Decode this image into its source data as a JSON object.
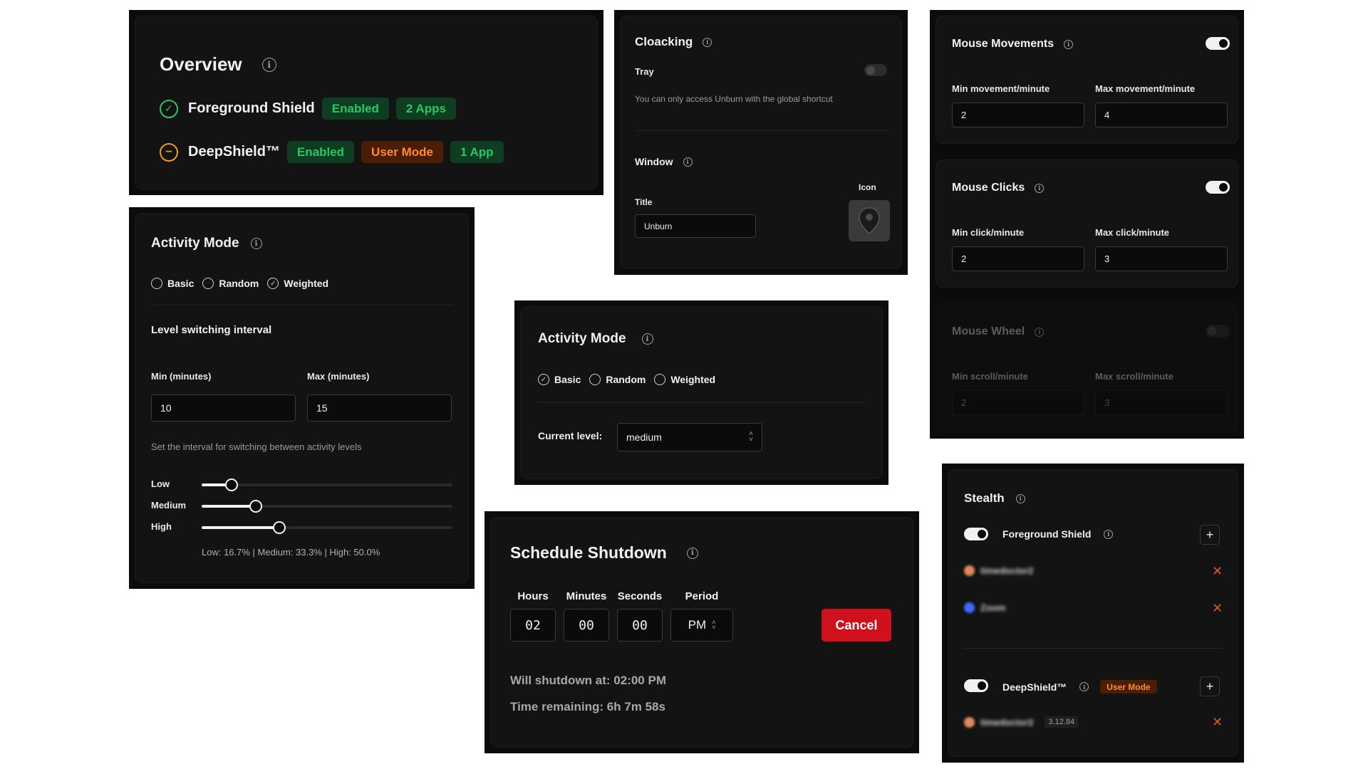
{
  "overview": {
    "title": "Overview",
    "rows": [
      {
        "name": "Foreground Shield",
        "badges": [
          "Enabled",
          "2 Apps"
        ]
      },
      {
        "name": "DeepShield™",
        "badges": [
          "Enabled",
          "User Mode",
          "1 App"
        ]
      }
    ]
  },
  "cloaking": {
    "title": "Cloacking",
    "tray_label": "Tray",
    "tray_note": "You can only access Unburn with the global shortcut",
    "window_title": "Window",
    "title_label": "Title",
    "title_value": "Unburn",
    "icon_label": "Icon"
  },
  "mouse": {
    "movements": {
      "title": "Mouse Movements",
      "min_label": "Min movement/minute",
      "max_label": "Max movement/minute",
      "min_value": "2",
      "max_value": "4"
    },
    "clicks": {
      "title": "Mouse Clicks",
      "min_label": "Min click/minute",
      "max_label": "Max click/minute",
      "min_value": "2",
      "max_value": "3"
    },
    "wheel": {
      "title": "Mouse Wheel",
      "min_label": "Min scroll/minute",
      "max_label": "Max scroll/minute",
      "min_value": "2",
      "max_value": "3"
    }
  },
  "activity_weighted": {
    "title": "Activity Mode",
    "options": [
      "Basic",
      "Random",
      "Weighted"
    ],
    "interval_title": "Level switching interval",
    "min_label": "Min (minutes)",
    "max_label": "Max (minutes)",
    "min_value": "10",
    "max_value": "15",
    "help": "Set the interval for switching between activity levels",
    "sliders": [
      {
        "label": "Low",
        "value": 0.12
      },
      {
        "label": "Medium",
        "value": 0.215
      },
      {
        "label": "High",
        "value": 0.31
      }
    ],
    "summary": "Low: 16.7% | Medium: 33.3% | High: 50.0%"
  },
  "activity_basic": {
    "title": "Activity Mode",
    "options": [
      "Basic",
      "Random",
      "Weighted"
    ],
    "current_label": "Current level:",
    "current_value": "medium"
  },
  "schedule": {
    "title": "Schedule Shutdown",
    "hours_label": "Hours",
    "minutes_label": "Minutes",
    "seconds_label": "Seconds",
    "period_label": "Period",
    "hours": "02",
    "minutes": "00",
    "seconds": "00",
    "period": "PM",
    "cancel": "Cancel",
    "will_shutdown": "Will shutdown at: 02:00 PM",
    "remaining": "Time remaining: 6h 7m 58s"
  },
  "stealth": {
    "title": "Stealth",
    "foreground_label": "Foreground Shield",
    "foreground_apps": [
      "timedoctor2",
      "Zoom"
    ],
    "deep_label": "DeepShield™",
    "deep_badge": "User Mode",
    "deep_app": "timedoctor2",
    "deep_app_version": "3.12.84"
  }
}
